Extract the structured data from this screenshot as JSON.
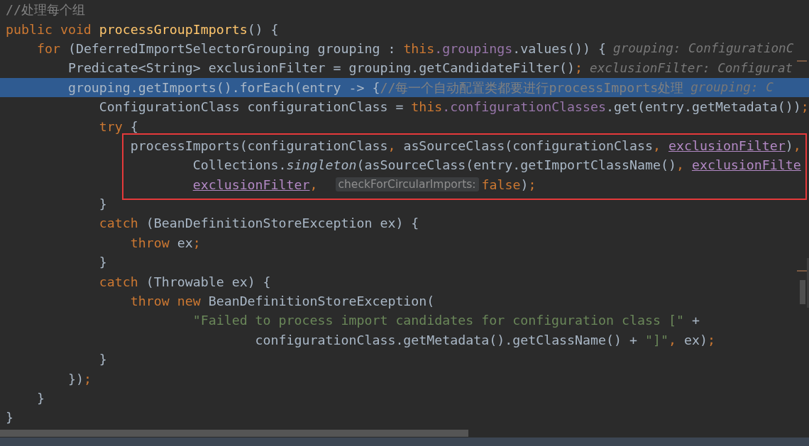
{
  "lines": [
    {
      "selected": false,
      "boxed": false,
      "tokens": [
        {
          "kind": "comment",
          "text": "//处理每个组"
        }
      ]
    },
    {
      "selected": false,
      "boxed": false,
      "tokens": [
        {
          "kind": "keyword",
          "text": "public void "
        },
        {
          "kind": "method",
          "text": "processGroupImports"
        },
        {
          "kind": "plain",
          "text": "() {"
        }
      ]
    },
    {
      "selected": false,
      "boxed": false,
      "tokens": [
        {
          "kind": "keyword",
          "text": "    for "
        },
        {
          "kind": "plain",
          "text": "(DeferredImportSelectorGrouping grouping : "
        },
        {
          "kind": "keyword",
          "text": "this"
        },
        {
          "kind": "field",
          "text": ".groupings"
        },
        {
          "kind": "plain",
          "text": ".values()) {"
        },
        {
          "kind": "hint",
          "text": "grouping: ConfigurationC"
        }
      ]
    },
    {
      "selected": false,
      "boxed": false,
      "tokens": [
        {
          "kind": "plain",
          "text": "        Predicate<String> exclusionFilter = grouping.getCandidateFilter()"
        },
        {
          "kind": "keyword",
          "text": ";"
        },
        {
          "kind": "hint",
          "text": "exclusionFilter: Configurat"
        }
      ]
    },
    {
      "selected": true,
      "boxed": false,
      "tokens": [
        {
          "kind": "plain",
          "text": "        grouping.getImports().forEach(entry -> {"
        },
        {
          "kind": "comment",
          "text": "//每一个自动配置类都要进行processImports处理"
        },
        {
          "kind": "hint",
          "text": "grouping: C"
        }
      ]
    },
    {
      "selected": false,
      "boxed": false,
      "tokens": [
        {
          "kind": "plain",
          "text": "            ConfigurationClass configurationClass = "
        },
        {
          "kind": "keyword",
          "text": "this"
        },
        {
          "kind": "field",
          "text": ".configurationClasses"
        },
        {
          "kind": "plain",
          "text": ".get(entry.getMetadata())"
        },
        {
          "kind": "keyword",
          "text": ";"
        }
      ]
    },
    {
      "selected": false,
      "boxed": false,
      "tokens": [
        {
          "kind": "keyword",
          "text": "            try "
        },
        {
          "kind": "plain",
          "text": "{"
        }
      ]
    },
    {
      "selected": false,
      "boxed": true,
      "tokens": [
        {
          "kind": "plain",
          "text": "                processImports(configurationClass"
        },
        {
          "kind": "keyword",
          "text": ", "
        },
        {
          "kind": "plain",
          "text": "asSourceClass(configurationClass"
        },
        {
          "kind": "keyword",
          "text": ", "
        },
        {
          "kind": "captured",
          "text": "exclusionFilter"
        },
        {
          "kind": "plain",
          "text": ")"
        },
        {
          "kind": "keyword",
          "text": ","
        }
      ]
    },
    {
      "selected": false,
      "boxed": true,
      "tokens": [
        {
          "kind": "plain",
          "text": "                        Collections."
        },
        {
          "kind": "static",
          "text": "singleton"
        },
        {
          "kind": "plain",
          "text": "(asSourceClass(entry.getImportClassName()"
        },
        {
          "kind": "keyword",
          "text": ", "
        },
        {
          "kind": "captured",
          "text": "exclusionFilte"
        }
      ]
    },
    {
      "selected": false,
      "boxed": true,
      "tokens": [
        {
          "kind": "captured",
          "text": "                        exclusionFilter"
        },
        {
          "kind": "keyword",
          "text": ", "
        },
        {
          "kind": "param",
          "text": "checkForCircularImports:"
        },
        {
          "kind": "keyword",
          "text": "false"
        },
        {
          "kind": "plain",
          "text": ")"
        },
        {
          "kind": "keyword",
          "text": ";"
        }
      ]
    },
    {
      "selected": false,
      "boxed": false,
      "tokens": [
        {
          "kind": "plain",
          "text": "            }"
        }
      ]
    },
    {
      "selected": false,
      "boxed": false,
      "tokens": [
        {
          "kind": "keyword",
          "text": "            catch "
        },
        {
          "kind": "plain",
          "text": "(BeanDefinitionStoreException ex) {"
        }
      ]
    },
    {
      "selected": false,
      "boxed": false,
      "tokens": [
        {
          "kind": "keyword",
          "text": "                throw "
        },
        {
          "kind": "plain",
          "text": "ex"
        },
        {
          "kind": "keyword",
          "text": ";"
        }
      ]
    },
    {
      "selected": false,
      "boxed": false,
      "tokens": [
        {
          "kind": "plain",
          "text": "            }"
        }
      ]
    },
    {
      "selected": false,
      "boxed": false,
      "tokens": [
        {
          "kind": "keyword",
          "text": "            catch "
        },
        {
          "kind": "plain",
          "text": "(Throwable ex) {"
        }
      ]
    },
    {
      "selected": false,
      "boxed": false,
      "tokens": [
        {
          "kind": "keyword",
          "text": "                throw new "
        },
        {
          "kind": "plain",
          "text": "BeanDefinitionStoreException("
        }
      ]
    },
    {
      "selected": false,
      "boxed": false,
      "tokens": [
        {
          "kind": "string",
          "text": "                        \"Failed to process import candidates for configuration class [\""
        },
        {
          "kind": "plain",
          "text": " +"
        }
      ]
    },
    {
      "selected": false,
      "boxed": false,
      "tokens": [
        {
          "kind": "plain",
          "text": "                                configurationClass.getMetadata().getClassName() + "
        },
        {
          "kind": "string",
          "text": "\"]\""
        },
        {
          "kind": "keyword",
          "text": ", "
        },
        {
          "kind": "plain",
          "text": "ex)"
        },
        {
          "kind": "keyword",
          "text": ";"
        }
      ]
    },
    {
      "selected": false,
      "boxed": false,
      "tokens": [
        {
          "kind": "plain",
          "text": "            }"
        }
      ]
    },
    {
      "selected": false,
      "boxed": false,
      "tokens": [
        {
          "kind": "plain",
          "text": "        })"
        },
        {
          "kind": "keyword",
          "text": ";"
        }
      ]
    },
    {
      "selected": false,
      "boxed": false,
      "tokens": [
        {
          "kind": "plain",
          "text": "    }"
        }
      ]
    },
    {
      "selected": false,
      "boxed": false,
      "tokens": [
        {
          "kind": "plain",
          "text": "}"
        }
      ]
    }
  ]
}
